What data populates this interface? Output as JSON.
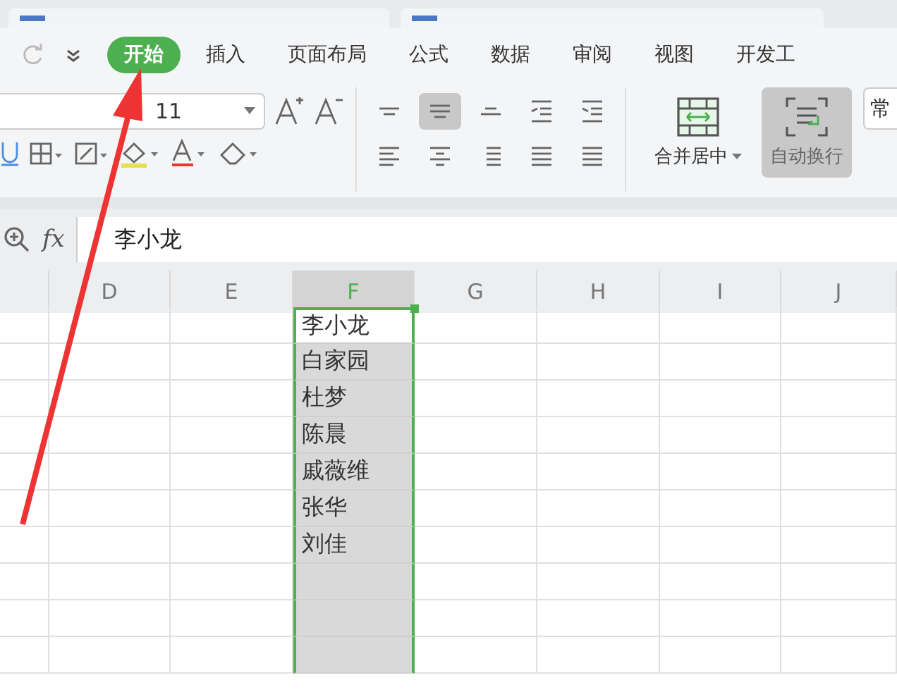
{
  "menu_tabs": [
    {
      "label": "开始",
      "selected": true
    },
    {
      "label": "插入",
      "selected": false
    },
    {
      "label": "页面布局",
      "selected": false
    },
    {
      "label": "公式",
      "selected": false
    },
    {
      "label": "数据",
      "selected": false
    },
    {
      "label": "审阅",
      "selected": false
    },
    {
      "label": "视图",
      "selected": false
    },
    {
      "label": "开发工",
      "selected": false
    }
  ],
  "ribbon": {
    "font_size": "11",
    "align_buttons": [
      {
        "kind": "top",
        "on": false
      },
      {
        "kind": "middle",
        "on": true
      },
      {
        "kind": "bottom",
        "on": false
      },
      {
        "kind": "outdent",
        "on": false
      },
      {
        "kind": "indent",
        "on": false
      }
    ],
    "merge_label": "合并居中",
    "wrap_label": "自动换行",
    "wrap_on": true,
    "style_partial": "常"
  },
  "formula_bar": {
    "fx": "fx",
    "value": "李小龙"
  },
  "columns": [
    {
      "label": "D",
      "selected": false
    },
    {
      "label": "E",
      "selected": false
    },
    {
      "label": "F",
      "selected": true
    },
    {
      "label": "G",
      "selected": false
    },
    {
      "label": "H",
      "selected": false
    },
    {
      "label": "I",
      "selected": false
    },
    {
      "label": "J",
      "selected": false
    }
  ],
  "column_f_cells": [
    {
      "text": "李小龙",
      "active": true
    },
    {
      "text": "白家园",
      "active": false
    },
    {
      "text": "杜梦",
      "active": false
    },
    {
      "text": "陈晨",
      "active": false
    },
    {
      "text": "戚薇维",
      "active": false
    },
    {
      "text": "张华",
      "active": false
    },
    {
      "text": "刘佳",
      "active": false
    }
  ]
}
